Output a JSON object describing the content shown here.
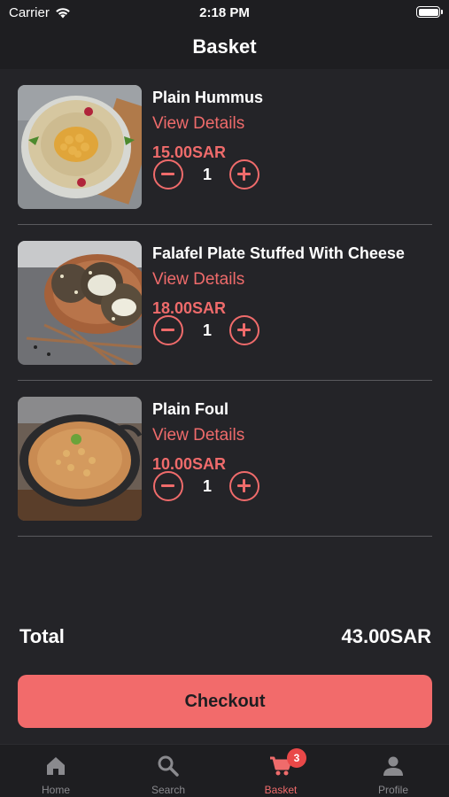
{
  "status_bar": {
    "carrier": "Carrier",
    "time": "2:18 PM",
    "wifi_icon": "wifi-icon",
    "battery_icon": "battery-icon"
  },
  "header": {
    "title": "Basket"
  },
  "items": [
    {
      "name": "Plain Hummus",
      "details_label": "View Details",
      "price": "15.00SAR",
      "quantity": "1",
      "image": "plain-hummus-photo"
    },
    {
      "name": "Falafel Plate Stuffed With Cheese",
      "details_label": "View Details",
      "price": "18.00SAR",
      "quantity": "1",
      "image": "falafel-plate-photo"
    },
    {
      "name": "Plain Foul",
      "details_label": "View Details",
      "price": "10.00SAR",
      "quantity": "1",
      "image": "plain-foul-photo"
    }
  ],
  "total": {
    "label": "Total",
    "value": "43.00SAR"
  },
  "checkout": {
    "label": "Checkout"
  },
  "tabbar": {
    "tabs": [
      {
        "label": "Home",
        "icon": "home-icon"
      },
      {
        "label": "Search",
        "icon": "search-icon"
      },
      {
        "label": "Basket",
        "icon": "cart-icon",
        "badge": "3",
        "active": true
      },
      {
        "label": "Profile",
        "icon": "person-icon"
      }
    ]
  },
  "colors": {
    "accent": "#ef6b6b",
    "background": "#1e1e21",
    "content_background": "#242428",
    "badge": "#e94848"
  }
}
